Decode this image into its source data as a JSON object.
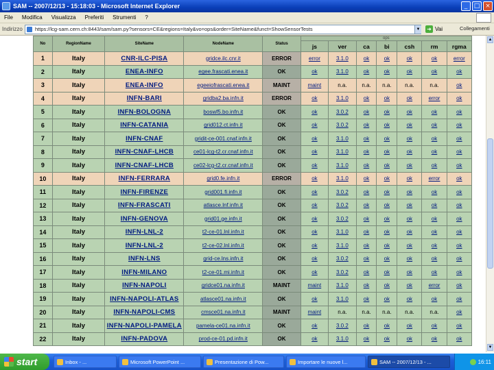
{
  "window": {
    "title": "SAM -- 2007/12/13 - 15:18:03 - Microsoft Internet Explorer",
    "buttons": [
      "_",
      "□",
      "×"
    ]
  },
  "menu": [
    "File",
    "Modifica",
    "Visualizza",
    "Preferiti",
    "Strumenti",
    "?"
  ],
  "address": {
    "label": "Indirizzo",
    "url": "https://lcg-sam.cern.ch:8443/sam/sam.py?sensors=CE&regions=Italy&vo=ops&order=SiteName&funct=ShowSensorTests",
    "go_label": "Vai",
    "links_label": "Collegamenti"
  },
  "table": {
    "tests_group_label": "ops",
    "headers": [
      "No",
      "RegionName",
      "SiteName",
      "NodeName",
      "Status",
      "js",
      "ver",
      "ca",
      "bi",
      "csh",
      "rm",
      "rgma"
    ],
    "rows": [
      {
        "no": "1",
        "region": "Italy",
        "site": "CNR-ILC-PISA",
        "node": "gridce.ilc.cnr.it",
        "status": "ERROR",
        "kind": "error",
        "tests": [
          "error",
          "3.1.0",
          "ok",
          "ok",
          "ok",
          "ok",
          "error"
        ]
      },
      {
        "no": "2",
        "region": "Italy",
        "site": "ENEA-INFO",
        "node": "egee.frascati.enea.it",
        "status": "OK",
        "kind": "ok",
        "tests": [
          "ok",
          "3.1.0",
          "ok",
          "ok",
          "ok",
          "ok",
          "ok"
        ]
      },
      {
        "no": "3",
        "region": "Italy",
        "site": "ENEA-INFO",
        "node": "egeeiofrascati.enea.it",
        "status": "MAINT",
        "kind": "maint",
        "tests": [
          "maint",
          "n.a.",
          "n.a.",
          "n.a.",
          "n.a.",
          "n.a.",
          "ok"
        ]
      },
      {
        "no": "4",
        "region": "Italy",
        "site": "INFN-BARI",
        "node": "gridba2.ba.infn.it",
        "status": "ERROR",
        "kind": "error",
        "tests": [
          "ok",
          "3.1.0",
          "ok",
          "ok",
          "ok",
          "error",
          "ok"
        ]
      },
      {
        "no": "5",
        "region": "Italy",
        "site": "INFN-BOLOGNA",
        "node": "boswf5.bo.infn.it",
        "status": "OK",
        "kind": "ok",
        "tests": [
          "ok",
          "3.0.2",
          "ok",
          "ok",
          "ok",
          "ok",
          "ok"
        ]
      },
      {
        "no": "6",
        "region": "Italy",
        "site": "INFN-CATANIA",
        "node": "grid012.ct.infn.it",
        "status": "OK",
        "kind": "ok",
        "tests": [
          "ok",
          "3.0.2",
          "ok",
          "ok",
          "ok",
          "ok",
          "ok"
        ]
      },
      {
        "no": "7",
        "region": "Italy",
        "site": "INFN-CNAF",
        "node": "gridit-ce-001.cnaf.infn.it",
        "status": "OK",
        "kind": "ok",
        "tests": [
          "ok",
          "3.1.0",
          "ok",
          "ok",
          "ok",
          "ok",
          "ok"
        ]
      },
      {
        "no": "8",
        "region": "Italy",
        "site": "INFN-CNAF-LHCB",
        "node": "ce01-lcg-t2.cr.cnaf.infn.it",
        "status": "OK",
        "kind": "ok",
        "tests": [
          "ok",
          "3.1.0",
          "ok",
          "ok",
          "ok",
          "ok",
          "ok"
        ]
      },
      {
        "no": "9",
        "region": "Italy",
        "site": "INFN-CNAF-LHCB",
        "node": "ce02-lcg-t2.cr.cnaf.infn.it",
        "status": "OK",
        "kind": "ok",
        "tests": [
          "ok",
          "3.1.0",
          "ok",
          "ok",
          "ok",
          "ok",
          "ok"
        ]
      },
      {
        "no": "10",
        "region": "Italy",
        "site": "INFN-FERRARA",
        "node": "grid0.fe.infn.it",
        "status": "ERROR",
        "kind": "error",
        "tests": [
          "ok",
          "3.1.0",
          "ok",
          "ok",
          "ok",
          "error",
          "ok"
        ]
      },
      {
        "no": "11",
        "region": "Italy",
        "site": "INFN-FIRENZE",
        "node": "grid001.fi.infn.it",
        "status": "OK",
        "kind": "ok",
        "tests": [
          "ok",
          "3.0.2",
          "ok",
          "ok",
          "ok",
          "ok",
          "ok"
        ]
      },
      {
        "no": "12",
        "region": "Italy",
        "site": "INFN-FRASCATI",
        "node": "atlasce.lnf.infn.it",
        "status": "OK",
        "kind": "ok",
        "tests": [
          "ok",
          "3.0.2",
          "ok",
          "ok",
          "ok",
          "ok",
          "ok"
        ]
      },
      {
        "no": "13",
        "region": "Italy",
        "site": "INFN-GENOVA",
        "node": "grid01.ge.infn.it",
        "status": "OK",
        "kind": "ok",
        "tests": [
          "ok",
          "3.0.2",
          "ok",
          "ok",
          "ok",
          "ok",
          "ok"
        ]
      },
      {
        "no": "14",
        "region": "Italy",
        "site": "INFN-LNL-2",
        "node": "t2-ce-01.lnl.infn.it",
        "status": "OK",
        "kind": "ok",
        "tests": [
          "ok",
          "3.1.0",
          "ok",
          "ok",
          "ok",
          "ok",
          "ok"
        ]
      },
      {
        "no": "15",
        "region": "Italy",
        "site": "INFN-LNL-2",
        "node": "t2-ce-02.lnl.infn.it",
        "status": "OK",
        "kind": "ok",
        "tests": [
          "ok",
          "3.1.0",
          "ok",
          "ok",
          "ok",
          "ok",
          "ok"
        ]
      },
      {
        "no": "16",
        "region": "Italy",
        "site": "INFN-LNS",
        "node": "grid-ce.lns.infn.it",
        "status": "OK",
        "kind": "ok",
        "tests": [
          "ok",
          "3.0.2",
          "ok",
          "ok",
          "ok",
          "ok",
          "ok"
        ]
      },
      {
        "no": "17",
        "region": "Italy",
        "site": "INFN-MILANO",
        "node": "t2-ce-01.mi.infn.it",
        "status": "OK",
        "kind": "ok",
        "tests": [
          "ok",
          "3.0.2",
          "ok",
          "ok",
          "ok",
          "ok",
          "ok"
        ]
      },
      {
        "no": "18",
        "region": "Italy",
        "site": "INFN-NAPOLI",
        "node": "gridce01.na.infn.it",
        "status": "MAINT",
        "kind": "ok",
        "tests": [
          "maint",
          "3.1.0",
          "ok",
          "ok",
          "ok",
          "error",
          "ok"
        ]
      },
      {
        "no": "19",
        "region": "Italy",
        "site": "INFN-NAPOLI-ATLAS",
        "node": "atlasce01.na.infn.it",
        "status": "OK",
        "kind": "ok",
        "tests": [
          "ok",
          "3.1.0",
          "ok",
          "ok",
          "ok",
          "ok",
          "ok"
        ]
      },
      {
        "no": "20",
        "region": "Italy",
        "site": "INFN-NAPOLI-CMS",
        "node": "cmsce01.na.infn.it",
        "status": "MAINT",
        "kind": "ok",
        "tests": [
          "maint",
          "n.a.",
          "n.a.",
          "n.a.",
          "n.a.",
          "n.a.",
          "ok"
        ]
      },
      {
        "no": "21",
        "region": "Italy",
        "site": "INFN-NAPOLI-PAMELA",
        "node": "pamela-ce01.na.infn.it",
        "status": "OK",
        "kind": "ok",
        "tests": [
          "ok",
          "3.0.2",
          "ok",
          "ok",
          "ok",
          "ok",
          "ok"
        ]
      },
      {
        "no": "22",
        "region": "Italy",
        "site": "INFN-PADOVA",
        "node": "prod-ce-01.pd.infn.it",
        "status": "OK",
        "kind": "ok",
        "tests": [
          "ok",
          "3.1.0",
          "ok",
          "ok",
          "ok",
          "ok",
          "ok"
        ]
      }
    ]
  },
  "taskbar": {
    "start_label": "start",
    "tasks": [
      "Inbox - ...",
      "Microsoft PowerPoint ...",
      "Presentazione di Pow...",
      "Importare le nuove l...",
      "SAM -- 2007/12/13 - ..."
    ],
    "active_index": 4,
    "clock": "16:11"
  },
  "colors": {
    "row_ok": "#b9d3b2",
    "row_error": "#efd4b8",
    "header": "#a9c0a2",
    "link": "#001a80"
  }
}
